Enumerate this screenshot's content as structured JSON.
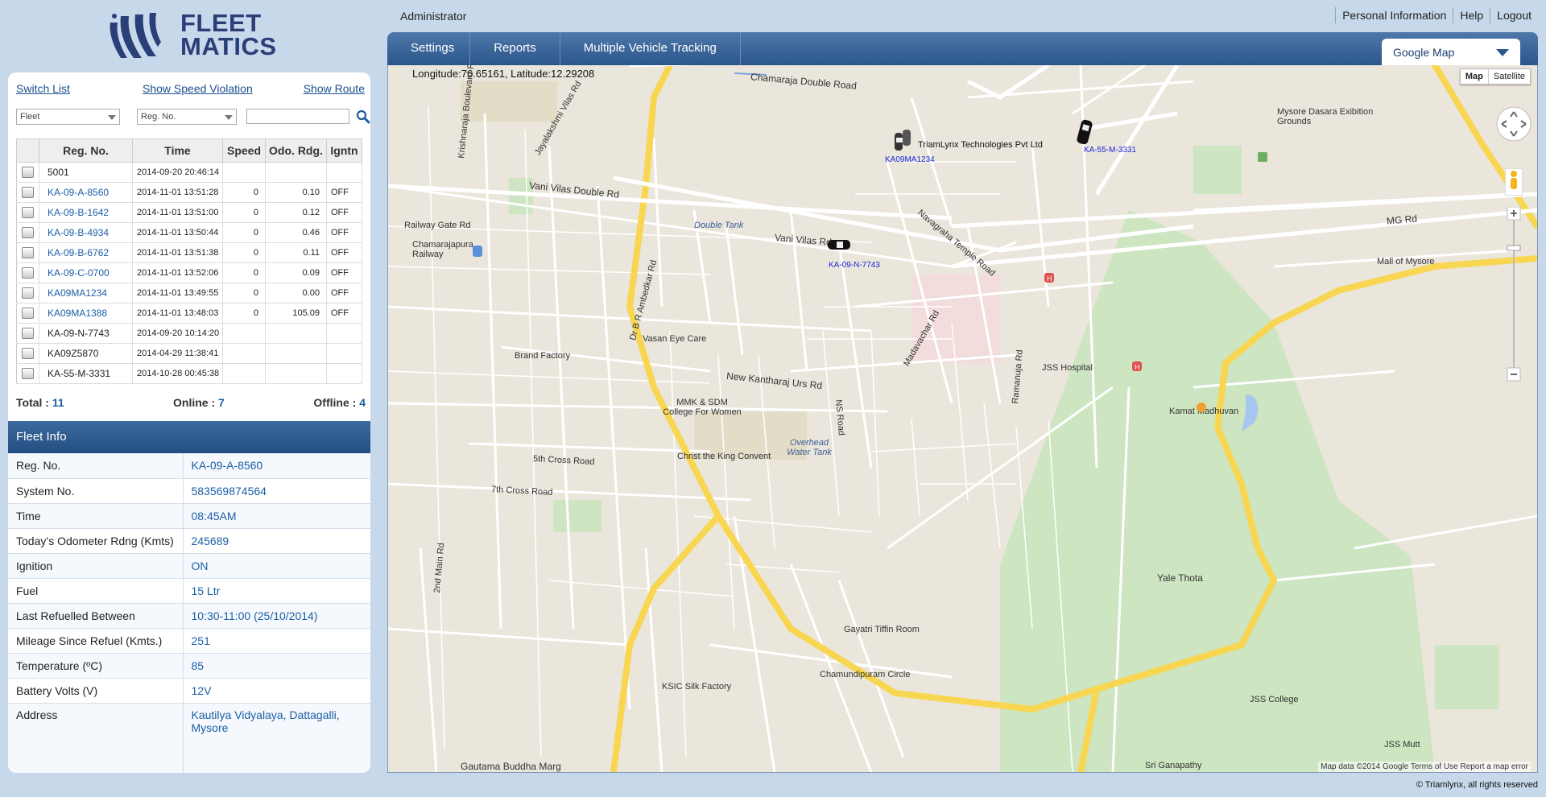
{
  "brand": {
    "name_line1": "FLEET",
    "name_line2": "MATICS"
  },
  "header": {
    "user": "Administrator",
    "links": [
      "Personal Information",
      "Help",
      "Logout"
    ]
  },
  "nav": {
    "tabs": [
      "Settings",
      "Reports",
      "Multiple Vehicle Tracking"
    ],
    "map_provider": "Google Map"
  },
  "left": {
    "links": {
      "switch_list": "Switch List",
      "speed_violation": "Show Speed Violation",
      "show_route": "Show Route"
    },
    "filters": {
      "fleet": "Fleet",
      "reg_no": "Reg. No.",
      "search_value": ""
    },
    "table": {
      "headers": [
        "Reg. No.",
        "Time",
        "Speed",
        "Odo. Rdg.",
        "Igntn"
      ],
      "rows": [
        {
          "reg": "5001",
          "time": "2014-09-20 20:46:14",
          "speed": "",
          "odo": "",
          "ign": "",
          "online": false
        },
        {
          "reg": "KA-09-A-8560",
          "time": "2014-11-01 13:51:28",
          "speed": "0",
          "odo": "0.10",
          "ign": "OFF",
          "online": true
        },
        {
          "reg": "KA-09-B-1642",
          "time": "2014-11-01 13:51:00",
          "speed": "0",
          "odo": "0.12",
          "ign": "OFF",
          "online": true
        },
        {
          "reg": "KA-09-B-4934",
          "time": "2014-11-01 13:50:44",
          "speed": "0",
          "odo": "0.46",
          "ign": "OFF",
          "online": true
        },
        {
          "reg": "KA-09-B-6762",
          "time": "2014-11-01 13:51:38",
          "speed": "0",
          "odo": "0.11",
          "ign": "OFF",
          "online": true
        },
        {
          "reg": "KA-09-C-0700",
          "time": "2014-11-01 13:52:06",
          "speed": "0",
          "odo": "0.09",
          "ign": "OFF",
          "online": true
        },
        {
          "reg": "KA09MA1234",
          "time": "2014-11-01 13:49:55",
          "speed": "0",
          "odo": "0.00",
          "ign": "OFF",
          "online": true
        },
        {
          "reg": "KA09MA1388",
          "time": "2014-11-01 13:48:03",
          "speed": "0",
          "odo": "105.09",
          "ign": "OFF",
          "online": true
        },
        {
          "reg": "KA-09-N-7743",
          "time": "2014-09-20 10:14:20",
          "speed": "",
          "odo": "",
          "ign": "",
          "online": false
        },
        {
          "reg": "KA09Z5870",
          "time": "2014-04-29 11:38:41",
          "speed": "",
          "odo": "",
          "ign": "",
          "online": false
        },
        {
          "reg": "KA-55-M-3331",
          "time": "2014-10-28 00:45:38",
          "speed": "",
          "odo": "",
          "ign": "",
          "online": false
        }
      ]
    },
    "counts": {
      "total_label": "Total :",
      "total": "11",
      "online_label": "Online :",
      "online": "7",
      "offline_label": "Offline :",
      "offline": "4"
    }
  },
  "fleet_info": {
    "title": "Fleet Info",
    "rows": [
      {
        "k": "Reg. No.",
        "v": "KA-09-A-8560"
      },
      {
        "k": "System No.",
        "v": "583569874564"
      },
      {
        "k": "Time",
        "v": "08:45AM"
      },
      {
        "k": "Today’s Odometer Rdng (Kmts)",
        "v": "245689"
      },
      {
        "k": "Ignition",
        "v": "ON"
      },
      {
        "k": "Fuel",
        "v": "15 Ltr"
      },
      {
        "k": "Last Refuelled Between",
        "v": "10:30-11:00 (25/10/2014)"
      },
      {
        "k": "Mileage Since Refuel (Kmts.)",
        "v": "251"
      },
      {
        "k": "Temperature (ºC)",
        "v": "85"
      },
      {
        "k": "Battery Volts (V)",
        "v": "12V"
      },
      {
        "k": "Address",
        "v": "Kautilya Vidyalaya, Dattagalli, Mysore"
      }
    ]
  },
  "map": {
    "coords": "Longitude:76.65161, Latitude:12.29208",
    "type_buttons": [
      "Map",
      "Satellite"
    ],
    "attribution": "Map data ©2014 Google   Terms of Use   Report a map error",
    "labels": [
      "Chamaraja Double Road",
      "Vani Vilas Double Rd",
      "Double Tank",
      "Vani Vilas Rd",
      "Navagraha Temple Road",
      "MG Rd",
      "Mall of Mysore",
      "Mysore Dasara Exibition Grounds",
      "JSS Hospital",
      "Brand Factory",
      "Vasan Eye Care",
      "New Kantharaj Urs Rd",
      "MMK & SDM College For Women",
      "Christ the King Convent",
      "Overhead Water Tank",
      "Kamat Madhuvan",
      "Yale Thota",
      "Gayatri Tiffin Room",
      "Chamundipuram Circle",
      "KSIC Silk Factory",
      "JSS College",
      "JSS Mutt",
      "Sri Ganapathy",
      "Gautama Buddha Marg",
      "Chamarajapura Railway",
      "Railway Gate Rd",
      "Krishnaraja Boulevard Rd",
      "Jayalakshmi Vilas Rd",
      "Dr B R Ambedkar Rd",
      "NS Road",
      "Madavachar Rd",
      "Ramanuja Rd",
      "7th Cross Road",
      "5th Cross Road",
      "2nd Main Rd",
      "TriamLynx Technologies Pvt Ltd"
    ],
    "vehicles": [
      "KA-55-M-3331",
      "KA-09-N-7743",
      "KA09MA1234"
    ]
  },
  "footer": {
    "copyright": "© Triamlynx, all rights reserved"
  }
}
